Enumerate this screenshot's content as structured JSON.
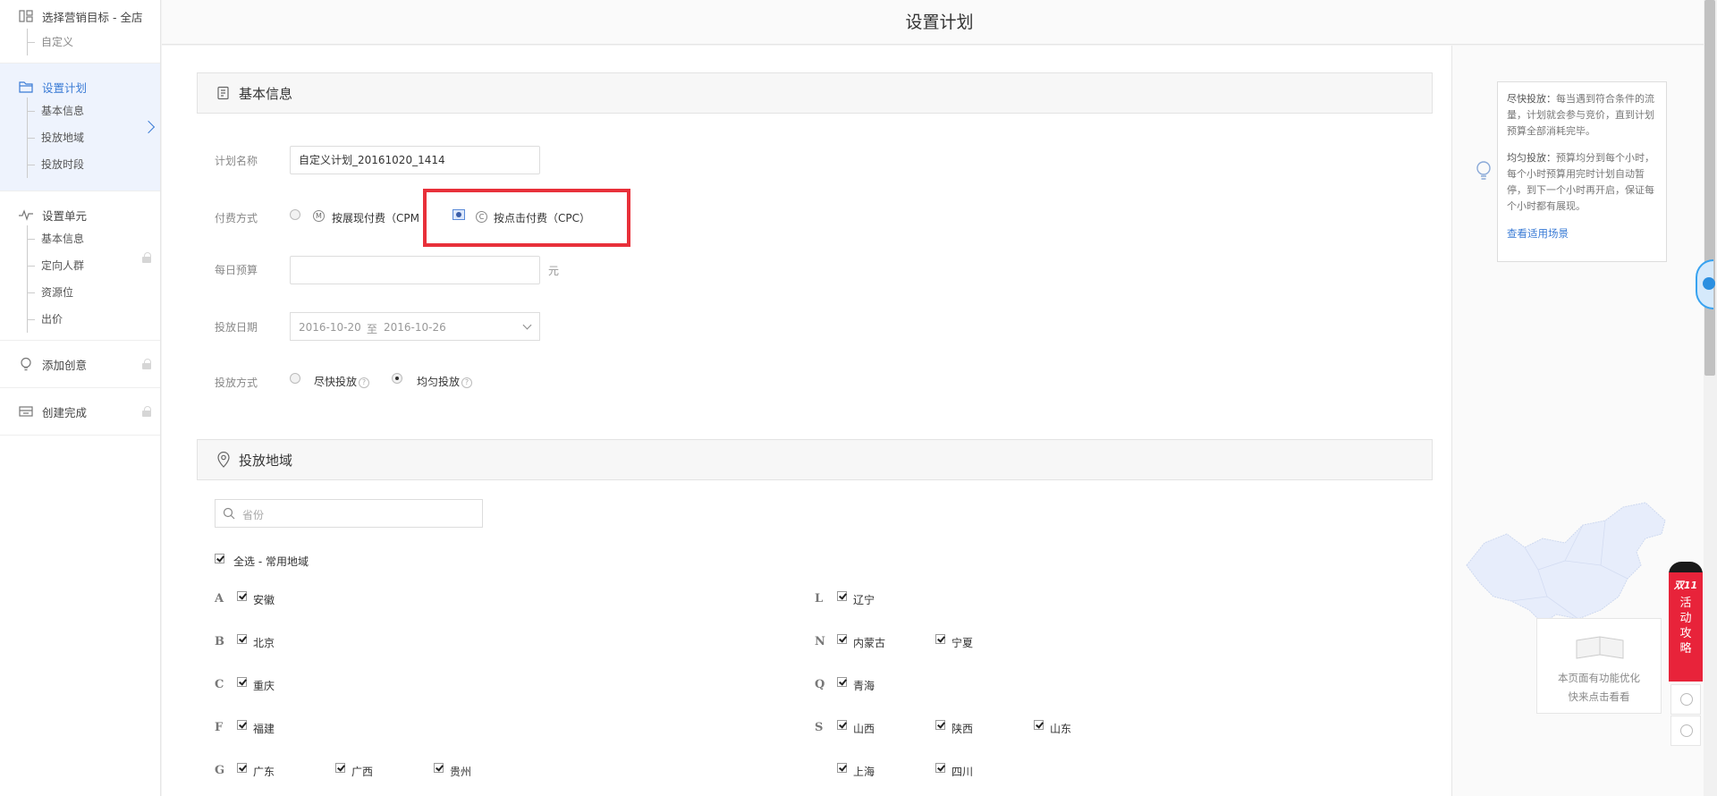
{
  "page_title": "设置计划",
  "sidebar": {
    "step1": {
      "title": "选择营销目标 - 全店",
      "items": [
        "自定义"
      ]
    },
    "step2": {
      "title": "设置计划",
      "items": [
        "基本信息",
        "投放地域",
        "投放时段"
      ]
    },
    "step3": {
      "title": "设置单元",
      "items": [
        "基本信息",
        "定向人群",
        "资源位",
        "出价"
      ]
    },
    "step4": {
      "title": "添加创意"
    },
    "step5": {
      "title": "创建完成"
    }
  },
  "basic_info": {
    "section_title": "基本信息",
    "plan_name_label": "计划名称",
    "plan_name_value": "自定义计划_20161020_1414",
    "payment_label": "付费方式",
    "payment_options": [
      {
        "badge": "M",
        "label": "按展现付费（CPM",
        "selected": false
      },
      {
        "badge": "C",
        "label": "按点击付费（CPC）",
        "selected": true
      }
    ],
    "budget_label": "每日预算",
    "budget_value": "",
    "budget_unit": "元",
    "date_label": "投放日期",
    "date_start": "2016-10-20",
    "date_sep": "至",
    "date_end": "2016-10-26",
    "delivery_label": "投放方式",
    "delivery_options": [
      {
        "label": "尽快投放",
        "selected": false
      },
      {
        "label": "均匀投放",
        "selected": true
      }
    ],
    "help_mark": "?"
  },
  "region": {
    "section_title": "投放地域",
    "search_placeholder": "省份",
    "select_all_label": "全选 - 常用地域",
    "groups": [
      {
        "letter": "A",
        "provinces": [
          "安徽"
        ]
      },
      {
        "letter": "B",
        "provinces": [
          "北京"
        ]
      },
      {
        "letter": "C",
        "provinces": [
          "重庆"
        ]
      },
      {
        "letter": "F",
        "provinces": [
          "福建"
        ]
      },
      {
        "letter": "G",
        "provinces": [
          "广东",
          "广西",
          "贵州"
        ]
      },
      {
        "letter": "L",
        "provinces": [
          "辽宁"
        ]
      },
      {
        "letter": "N",
        "provinces": [
          "内蒙古",
          "宁夏"
        ]
      },
      {
        "letter": "Q",
        "provinces": [
          "青海"
        ]
      },
      {
        "letter": "S",
        "provinces": [
          "山西",
          "陕西",
          "山东"
        ]
      },
      {
        "letter": "",
        "provinces": [
          "上海",
          "四川"
        ]
      }
    ]
  },
  "tips": {
    "fast_title": "尽快投放：",
    "fast_text": "每当遇到符合条件的流量，计划就会参与竞价，直到计划预算全部消耗完毕。",
    "even_title": "均匀投放：",
    "even_text": "预算均分到每个小时，每个小时预算用完时计划自动暂停，到下一个小时再开启，保证每个小时都有展现。",
    "link": "查看适用场景"
  },
  "optimization": {
    "line1": "本页面有功能优化",
    "line2": "快来点击看看"
  },
  "promo": {
    "top": "双11",
    "text": [
      "活",
      "动",
      "攻",
      "略"
    ]
  },
  "colors": {
    "accent": "#3a7bd5",
    "highlight": "#e8303a",
    "promo": "#e8233a"
  }
}
